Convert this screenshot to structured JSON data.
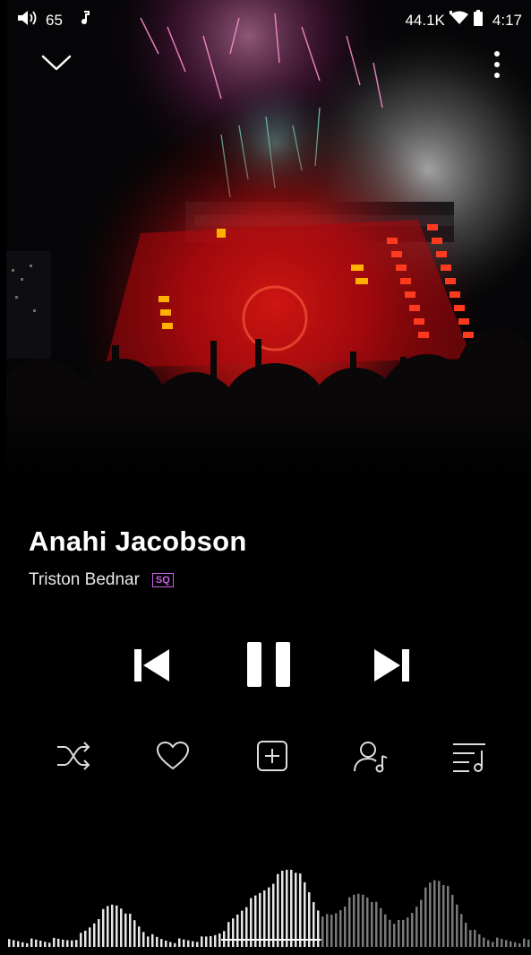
{
  "status_bar": {
    "volume_level": "65",
    "sample_rate": "44.1K",
    "time": "4:17"
  },
  "track": {
    "title": "Anahi Jacobson",
    "artist": "Triston Bednar",
    "quality_badge": "SQ"
  },
  "icons": {
    "collapse": "chevron-down-icon",
    "more": "more-vertical-icon",
    "previous": "skip-previous-icon",
    "pause": "pause-icon",
    "next": "skip-next-icon",
    "shuffle": "shuffle-icon",
    "favorite": "heart-icon",
    "add": "add-to-playlist-icon",
    "artist": "artist-icon",
    "queue": "queue-icon"
  },
  "playback": {
    "progress_fraction": 0.6
  },
  "colors": {
    "accent_badge": "#c964e6",
    "background": "#000000",
    "stage_red": "#e8141a"
  }
}
